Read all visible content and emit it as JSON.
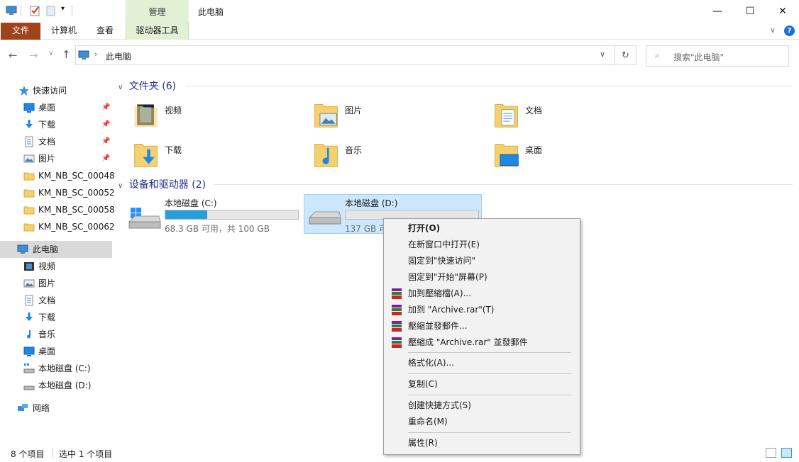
{
  "titlebar": {
    "manage_tab": "管理",
    "window_title": "此电脑",
    "minimize": "—",
    "maximize": "☐",
    "close": "✕"
  },
  "ribbon": {
    "tabs": [
      "文件",
      "计算机",
      "查看",
      "驱动器工具"
    ],
    "help": "?"
  },
  "address": {
    "path": "此电脑",
    "search_placeholder": "搜索\"此电脑\""
  },
  "sidebar": {
    "quick_access": "快速访问",
    "quick_items": [
      {
        "label": "桌面",
        "icon": "desktop-icon",
        "pinned": true
      },
      {
        "label": "下载",
        "icon": "download-icon",
        "pinned": true
      },
      {
        "label": "文档",
        "icon": "document-icon",
        "pinned": true
      },
      {
        "label": "图片",
        "icon": "picture-icon",
        "pinned": true
      },
      {
        "label": "KM_NB_SC_00048",
        "icon": "folder-icon"
      },
      {
        "label": "KM_NB_SC_00052",
        "icon": "folder-icon"
      },
      {
        "label": "KM_NB_SC_00058",
        "icon": "folder-icon"
      },
      {
        "label": "KM_NB_SC_00062",
        "icon": "folder-icon"
      }
    ],
    "this_pc": "此电脑",
    "pc_items": [
      {
        "label": "视频",
        "icon": "video-icon"
      },
      {
        "label": "图片",
        "icon": "picture-icon"
      },
      {
        "label": "文档",
        "icon": "document-icon"
      },
      {
        "label": "下载",
        "icon": "download-icon"
      },
      {
        "label": "音乐",
        "icon": "music-icon"
      },
      {
        "label": "桌面",
        "icon": "desktop-icon"
      },
      {
        "label": "本地磁盘 (C:)",
        "icon": "drive-c-icon"
      },
      {
        "label": "本地磁盘 (D:)",
        "icon": "drive-d-icon"
      }
    ],
    "network": "网络"
  },
  "content": {
    "folders_header": "文件夹 (6)",
    "folders": [
      {
        "name": "视频",
        "icon": "video-folder-icon"
      },
      {
        "name": "图片",
        "icon": "picture-folder-icon"
      },
      {
        "name": "文档",
        "icon": "document-folder-icon"
      },
      {
        "name": "下载",
        "icon": "download-folder-icon"
      },
      {
        "name": "音乐",
        "icon": "music-folder-icon"
      },
      {
        "name": "桌面",
        "icon": "desktop-folder-icon"
      }
    ],
    "drives_header": "设备和驱动器 (2)",
    "drives": [
      {
        "name": "本地磁盘 (C:)",
        "free": "68.3 GB 可用，共 100 GB",
        "used_fraction": 0.317
      },
      {
        "name": "本地磁盘 (D:)",
        "free": "137 GB 可",
        "used_fraction": 0.0
      }
    ]
  },
  "context_menu": {
    "open": "打开(O)",
    "open_new_window": "在新窗口中打开(E)",
    "pin_quick": "固定到\"快速访问\"",
    "pin_start": "固定到\"开始\"屏幕(P)",
    "rar_add": "加到壓縮檔(A)...",
    "rar_add_archive": "加到 \"Archive.rar\"(T)",
    "rar_email": "壓縮並發郵件...",
    "rar_archive_email": "壓縮成 \"Archive.rar\" 並發郵件",
    "format": "格式化(A)...",
    "copy": "复制(C)",
    "shortcut": "创建快捷方式(S)",
    "rename": "重命名(M)",
    "properties": "属性(R)"
  },
  "status": {
    "items": "8 个项目",
    "selected": "选中 1 个项目"
  },
  "colors": {
    "accent": "#26a0da",
    "file_tab": "#a0431d",
    "manage_tab": "#e2f1d5",
    "group_header": "#1e3287",
    "selection": "#cce8ff"
  }
}
